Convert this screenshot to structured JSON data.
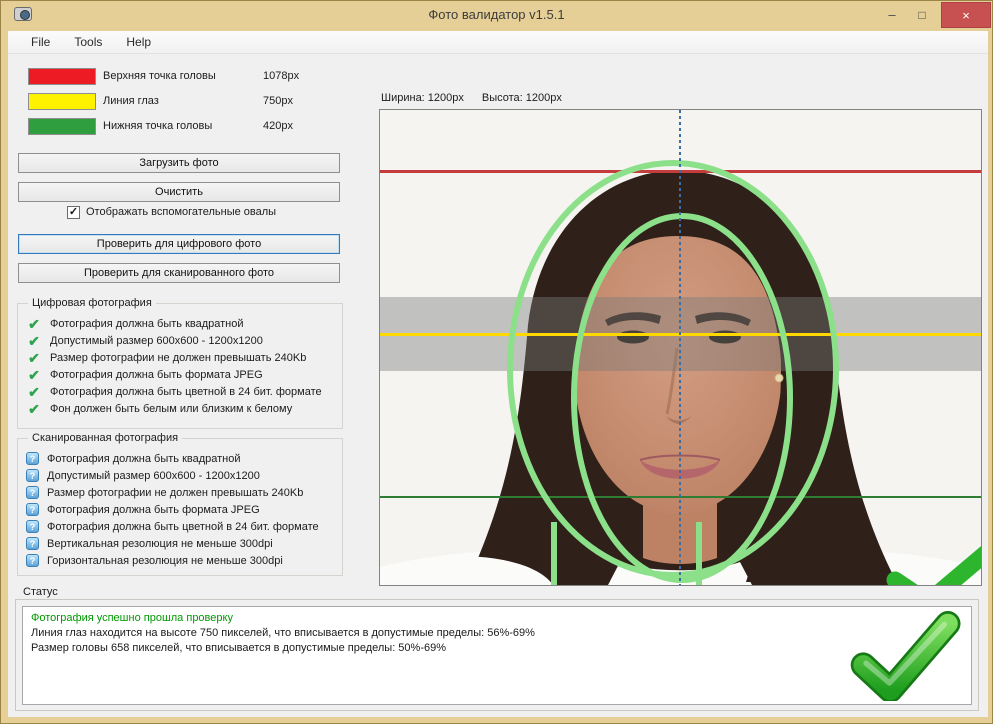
{
  "window": {
    "title": "Фото валидатор v1.5.1",
    "controls": {
      "minimize": "–",
      "maximize": "□",
      "close": "×"
    }
  },
  "menu": {
    "items": {
      "file": "File",
      "tools": "Tools",
      "help": "Help"
    }
  },
  "legend": {
    "items": [
      {
        "label": "Верхняя точка головы",
        "value": "1078px",
        "color": "#ed1c24"
      },
      {
        "label": "Линия глаз",
        "value": "750px",
        "color": "#fff200"
      },
      {
        "label": "Нижняя точка головы",
        "value": "420px",
        "color": "#2e9e3e"
      }
    ]
  },
  "actions": {
    "load": "Загрузить фото",
    "clear": "Очистить",
    "checkbox_label": "Отображать вспомогательные овалы",
    "checkbox_checked": true,
    "check_digital": "Проверить для цифрового фото",
    "check_scanned": "Проверить для сканированного фото"
  },
  "icons": {
    "check_glyph": "✔",
    "question_glyph": "?",
    "checkbox_glyph": "✓"
  },
  "digital_group": {
    "title": "Цифровая фотография",
    "items": [
      "Фотография должна быть квадратной",
      "Допустимый размер 600x600 - 1200x1200",
      "Размер фотографии не должен превышать 240Kb",
      "Фотография должна быть формата JPEG",
      "Фотография должна быть цветной в 24 бит. формате",
      "Фон должен быть белым или близким к белому"
    ]
  },
  "scanned_group": {
    "title": "Сканированная фотография",
    "items": [
      "Фотография должна быть квадратной",
      "Допустимый размер 600x600 - 1200x1200",
      "Размер фотографии не должен превышать 240Kb",
      "Фотография должна быть формата JPEG",
      "Фотография должна быть цветной в 24 бит. формате",
      "Вертикальная резолюция не меньше 300dpi",
      "Горизонтальная резолюция не меньше 300dpi"
    ]
  },
  "preview": {
    "width_label": "Ширина: 1200px",
    "height_label": "Высота: 1200px"
  },
  "overlay": {
    "top_line_color": "#c43c3c",
    "eye_line_color": "#ffd800",
    "bottom_line_color": "#2f7d32",
    "oval_color": "#8ce08a",
    "center_line_color": "#3b6ea5"
  },
  "status": {
    "title": "Статус",
    "lines": [
      {
        "text": "Фотография успешно прошла проверку",
        "color": "#009900"
      },
      {
        "text": "Линия глаз находится на высоте 750 пикселей, что вписывается в допустимые пределы: 56%-69%",
        "color": "#1a1a1a"
      },
      {
        "text": "Размер головы 658 пикселей, что вписывается в допустимые пределы: 50%-69%",
        "color": "#1a1a1a"
      }
    ]
  }
}
